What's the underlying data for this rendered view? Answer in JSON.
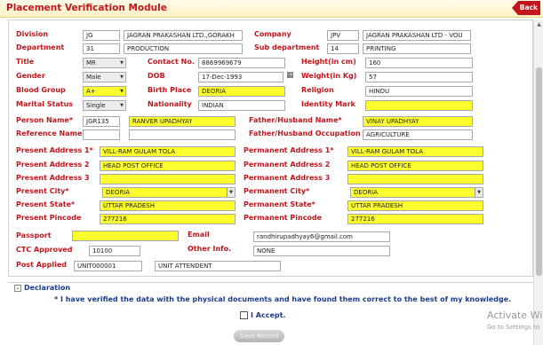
{
  "header": {
    "title": "Placement Verification Module",
    "back_label": "Back"
  },
  "form": {
    "division": {
      "label": "Division",
      "code": "JG",
      "name": "JAGRAN PRAKASHAN LTD.,GORAKH"
    },
    "company": {
      "label": "Company",
      "code": "JPV",
      "name": "JAGRAN PRAKASHAN LTD - VOU"
    },
    "department": {
      "label": "Department",
      "code": "31",
      "name": "PRODUCTION"
    },
    "sub_department": {
      "label": "Sub department",
      "code": "14",
      "name": "PRINTING"
    },
    "title": {
      "label": "Title",
      "value": "MR"
    },
    "contact_no": {
      "label": "Contact No.",
      "value": "8869969679"
    },
    "height": {
      "label": "Height(in cm)",
      "value": "160"
    },
    "gender": {
      "label": "Gender",
      "value": "Male"
    },
    "dob": {
      "label": "DOB",
      "value": "17-Dec-1993"
    },
    "weight": {
      "label": "Weight(in Kg)",
      "value": "57"
    },
    "blood_group": {
      "label": "Blood Group",
      "value": "A+"
    },
    "birth_place": {
      "label": "Birth Place",
      "value": "DEORIA"
    },
    "religion": {
      "label": "Religion",
      "value": "HINDU"
    },
    "marital_status": {
      "label": "Marital Status",
      "value": "Single"
    },
    "nationality": {
      "label": "Nationality",
      "value": "INDIAN"
    },
    "identity_mark": {
      "label": "Identity Mark",
      "value": ""
    },
    "person_name": {
      "label": "Person Name*",
      "code": "JGR135",
      "name": "RANVER UPADHYAY"
    },
    "father_name": {
      "label": "Father/Husband Name*",
      "value": "VINAY UPADHYAY"
    },
    "reference_name": {
      "label": "Reference Name",
      "code": "",
      "name": ""
    },
    "father_occupation": {
      "label": "Father/Husband Occupation",
      "value": "AGRICULTURE"
    },
    "present_address1": {
      "label": "Present Address 1*",
      "value": "VILL-RAM GULAM TOLA"
    },
    "permanent_address1": {
      "label": "Permanent Address 1*",
      "value": "VILL-RAM GULAM TOLA"
    },
    "present_address2": {
      "label": "Present Address 2",
      "value": "HEAD POST OFFICE"
    },
    "permanent_address2": {
      "label": "Permanent Address 2",
      "value": "HEAD POST OFFICE"
    },
    "present_address3": {
      "label": "Present Address 3",
      "value": ""
    },
    "permanent_address3": {
      "label": "Permanent Address 3",
      "value": ""
    },
    "present_city": {
      "label": "Present City*",
      "value": "DEORIA"
    },
    "permanent_city": {
      "label": "Permanent City*",
      "value": "DEORIA"
    },
    "present_state": {
      "label": "Present State*",
      "value": "UTTAR PRADESH"
    },
    "permanent_state": {
      "label": "Permanent State*",
      "value": "UTTAR PRADESH"
    },
    "present_pincode": {
      "label": "Present Pincode",
      "value": "277216"
    },
    "permanent_pincode": {
      "label": "Permanent Pincode",
      "value": "277216"
    },
    "passport": {
      "label": "Passport",
      "value": ""
    },
    "email": {
      "label": "Email",
      "value": "randhirupadhyay6@gmail.com"
    },
    "ctc_approved": {
      "label": "CTC Approved",
      "value": "10100"
    },
    "other_info": {
      "label": "Other Info.",
      "value": "NONE"
    },
    "post_applied": {
      "label": "Post Applied",
      "code": "UNIT000001",
      "name": "UNIT ATTENDENT"
    }
  },
  "declaration": {
    "heading": "Declaration",
    "text": "* I have verified the data with the physical documents and have found them correct to the best of my knowledge.",
    "accept_label": "I Accept.",
    "save_label": "Save Record"
  },
  "watermark": {
    "title": "Activate Win",
    "subtitle": "Go to Settings to"
  },
  "colors": {
    "required_label": "#c0171d",
    "blue_label": "#1b3d8c",
    "highlight": "#fbff2e",
    "back_button": "#c4141c"
  }
}
